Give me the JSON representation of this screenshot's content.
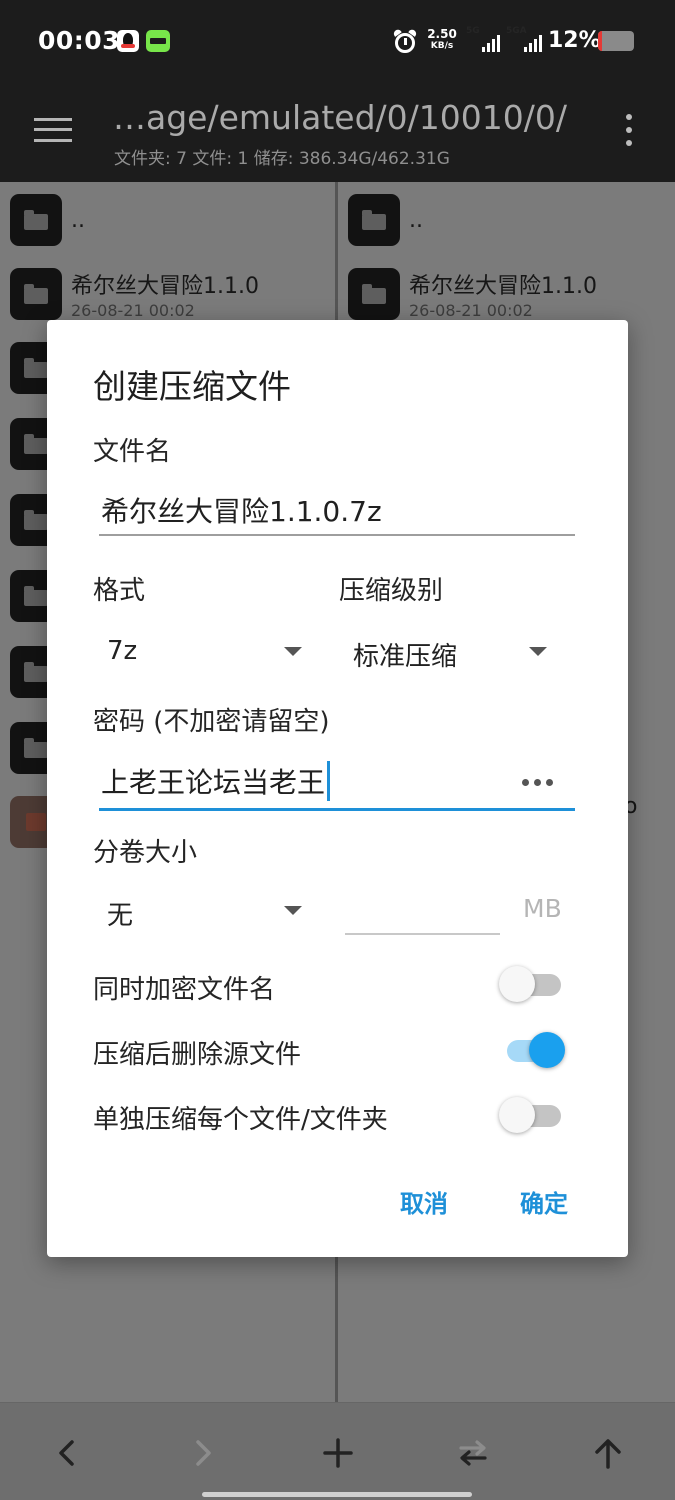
{
  "status_bar": {
    "time": "00:03",
    "net_speed_value": "2.50",
    "net_speed_unit": "KB/s",
    "signal1_label": "5G",
    "signal2_label": "5GA",
    "battery_percent": "12%",
    "battery_level": 0.12,
    "battery_color": "#e53935"
  },
  "app_bar": {
    "path": "…age/emulated/0/10010/0/",
    "summary": "文件夹: 7  文件: 1  储存: 386.34G/462.31G"
  },
  "left_pane": {
    "items": [
      {
        "name": "..",
        "date": ""
      },
      {
        "name": "希尔丝大冒险1.1.0",
        "date": "26-08-21 00:02"
      }
    ]
  },
  "right_pane": {
    "items": [
      {
        "name": "..",
        "date": ""
      },
      {
        "name": "希尔丝大冒险1.1.0",
        "date": "26-08-21 00:02"
      }
    ],
    "peek_text": "o"
  },
  "dialog": {
    "title": "创建压缩文件",
    "filename_label": "文件名",
    "filename_value": "希尔丝大冒险1.1.0.7z",
    "format_label": "格式",
    "format_value": "7z",
    "level_label": "压缩级别",
    "level_value": "标准压缩",
    "password_label": "密码 (不加密请留空)",
    "password_value": "上老王论坛当老王",
    "split_label": "分卷大小",
    "split_value": "无",
    "split_unit": "MB",
    "toggles": [
      {
        "label": "同时加密文件名",
        "on": false
      },
      {
        "label": "压缩后删除源文件",
        "on": true
      },
      {
        "label": "单独压缩每个文件/文件夹",
        "on": false
      }
    ],
    "cancel_label": "取消",
    "ok_label": "确定",
    "accent_color": "#1e90d8"
  },
  "bottom_bar": {
    "icons": [
      "back-arrow-icon",
      "forward-arrow-icon",
      "plus-icon",
      "swap-icon",
      "up-arrow-icon"
    ]
  }
}
